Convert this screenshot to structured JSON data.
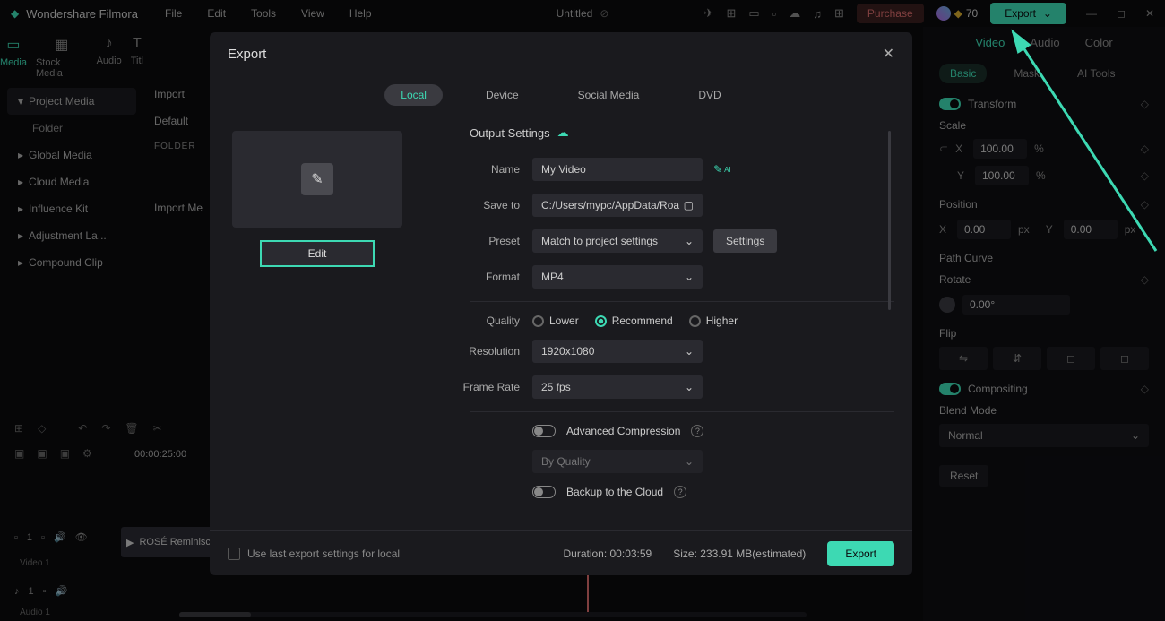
{
  "app": {
    "name": "Wondershare Filmora",
    "title": "Untitled"
  },
  "menu": [
    "File",
    "Edit",
    "Tools",
    "View",
    "Help"
  ],
  "topRight": {
    "purchase": "Purchase",
    "credits": "70",
    "export": "Export"
  },
  "mediaTabs": [
    {
      "label": "Media",
      "active": true
    },
    {
      "label": "Stock Media",
      "active": false
    },
    {
      "label": "Audio",
      "active": false
    },
    {
      "label": "Titl",
      "active": false
    }
  ],
  "sidebar": {
    "items": [
      "Project Media",
      "Global Media",
      "Cloud Media",
      "Influence Kit",
      "Adjustment La...",
      "Compound Clip"
    ],
    "folder": "Folder"
  },
  "midCol": {
    "import": "Import",
    "default": "Default",
    "folderHdr": "FOLDER",
    "importMe": "Import Me"
  },
  "rightPanel": {
    "tabs": [
      "Video",
      "Audio",
      "Color"
    ],
    "subtabs": [
      "Basic",
      "Mask",
      "AI Tools"
    ],
    "transform": "Transform",
    "scale": {
      "label": "Scale",
      "x": "100.00",
      "y": "100.00",
      "unit": "%"
    },
    "position": {
      "label": "Position",
      "x": "0.00",
      "y": "0.00",
      "unit": "px"
    },
    "pathCurve": "Path Curve",
    "rotate": {
      "label": "Rotate",
      "value": "0.00°"
    },
    "flip": "Flip",
    "compositing": "Compositing",
    "blendMode": {
      "label": "Blend Mode",
      "value": "Normal"
    },
    "reset": "Reset"
  },
  "timeline": {
    "time": "00:00:25:00",
    "video1": "Video 1",
    "audio1": "Audio 1",
    "clip": "ROSÉ Reminisc"
  },
  "modal": {
    "title": "Export",
    "tabs": [
      "Local",
      "Device",
      "Social Media",
      "DVD"
    ],
    "outputSettings": "Output Settings",
    "edit": "Edit",
    "fields": {
      "nameLabel": "Name",
      "nameValue": "My Video",
      "saveLabel": "Save to",
      "saveValue": "C:/Users/mypc/AppData/Roa",
      "presetLabel": "Preset",
      "presetValue": "Match to project settings",
      "formatLabel": "Format",
      "formatValue": "MP4",
      "qualityLabel": "Quality",
      "resolutionLabel": "Resolution",
      "resolutionValue": "1920x1080",
      "frameRateLabel": "Frame Rate",
      "frameRateValue": "25 fps"
    },
    "quality": {
      "lower": "Lower",
      "recommend": "Recommend",
      "higher": "Higher"
    },
    "settings": "Settings",
    "advComp": "Advanced Compression",
    "byQuality": "By Quality",
    "backup": "Backup to the Cloud",
    "footer": {
      "useLast": "Use last export settings for local",
      "duration": "Duration: 00:03:59",
      "size": "Size: 233.91 MB(estimated)",
      "export": "Export"
    }
  }
}
